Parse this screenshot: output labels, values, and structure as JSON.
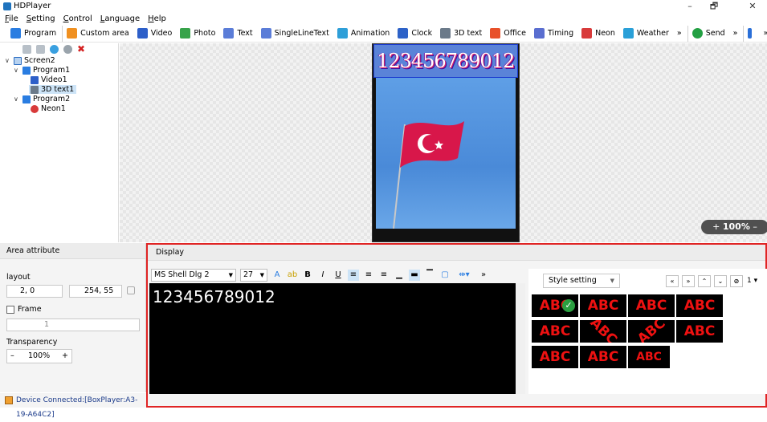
{
  "window": {
    "title": "HDPlayer",
    "minimize": "–",
    "restore": "🗗",
    "close": "✕"
  },
  "menu": [
    "File",
    "Setting",
    "Control",
    "Language",
    "Help"
  ],
  "toolbar": [
    {
      "label": "Program",
      "color": "#2a7de1"
    },
    {
      "label": "Custom area",
      "color": "#f09020"
    },
    {
      "label": "Video",
      "color": "#2d5fc9"
    },
    {
      "label": "Photo",
      "color": "#37a34a"
    },
    {
      "label": "Text",
      "color": "#5b7dd8"
    },
    {
      "label": "SingleLineText",
      "color": "#5b7dd8"
    },
    {
      "label": "Animation",
      "color": "#2e9fd8"
    },
    {
      "label": "Clock",
      "color": "#2d62c8"
    },
    {
      "label": "3D text",
      "color": "#6b7a8a"
    },
    {
      "label": "Office",
      "color": "#e8502a"
    },
    {
      "label": "Timing",
      "color": "#5a6ed0"
    },
    {
      "label": "Neon",
      "color": "#d83a3a"
    },
    {
      "label": "Weather",
      "color": "#2aa0d8"
    },
    {
      "label": "»",
      "color": ""
    },
    {
      "label": "Send",
      "color": "#23a043"
    },
    {
      "label": "»",
      "color": ""
    },
    {
      "label": "",
      "color": "#2a6fd8"
    },
    {
      "label": "»",
      "color": ""
    },
    {
      "label": "",
      "color": "#1e8ae0"
    }
  ],
  "tree": {
    "root": "Screen2",
    "program1": "Program1",
    "video1": "Video1",
    "text3d1": "3D text1",
    "program2": "Program2",
    "neon1": "Neon1"
  },
  "preview": {
    "text3d": "123456789012",
    "zoom": "100%",
    "zoom_minus": "–",
    "zoom_plus": "+"
  },
  "area": {
    "header": "Area attribute",
    "layout_label": "layout",
    "pos": "2, 0",
    "size": "254, 55",
    "frame_label": "Frame",
    "frame_value": "1",
    "transparency_label": "Transparency",
    "transparency_value": "100%",
    "minus": "–",
    "plus": "+"
  },
  "display": {
    "header": "Display",
    "font": "MS Shell Dlg 2",
    "size": "27",
    "editor_text": "123456789012",
    "style_setting": "Style setting",
    "style_index": "1",
    "styles": [
      "ABC",
      "ABC",
      "ABC",
      "ABC",
      "ABC",
      "ABC",
      "ABC",
      "ABC",
      "ABC",
      "ABC",
      "ABC"
    ]
  },
  "status": {
    "text": "Device Connected:[BoxPlayer:A3-19-A64C2]"
  }
}
